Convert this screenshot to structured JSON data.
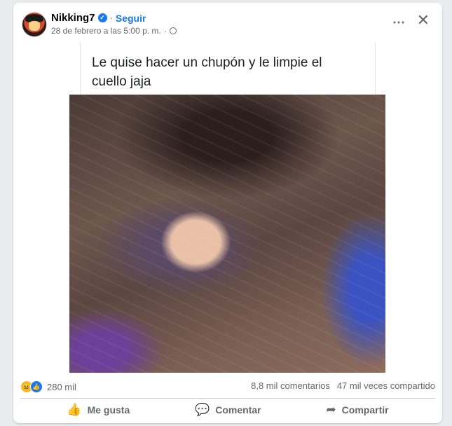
{
  "post": {
    "author": "Nikking7",
    "follow_label": "Seguir",
    "separator": "·",
    "timestamp": "28 de febrero a las 5:00 p. m.",
    "meta_separator": "·",
    "caption": "Le quise hacer un chupón y le limpie el cuello jaja"
  },
  "icons": {
    "more": "⋯",
    "close": "✕",
    "verified": "✓",
    "haha": "😆",
    "like_reaction": "👍",
    "like_action": "👍",
    "comment_action": "💬",
    "share_action": "➦"
  },
  "stats": {
    "reaction_count": "280 mil",
    "comments": "8,8 mil comentarios",
    "shares": "47 mil veces compartido"
  },
  "actions": {
    "like": "Me gusta",
    "comment": "Comentar",
    "share": "Compartir"
  },
  "colors": {
    "accent": "#1877f2",
    "muted_text": "#65676b",
    "haha": "#f7b928"
  }
}
